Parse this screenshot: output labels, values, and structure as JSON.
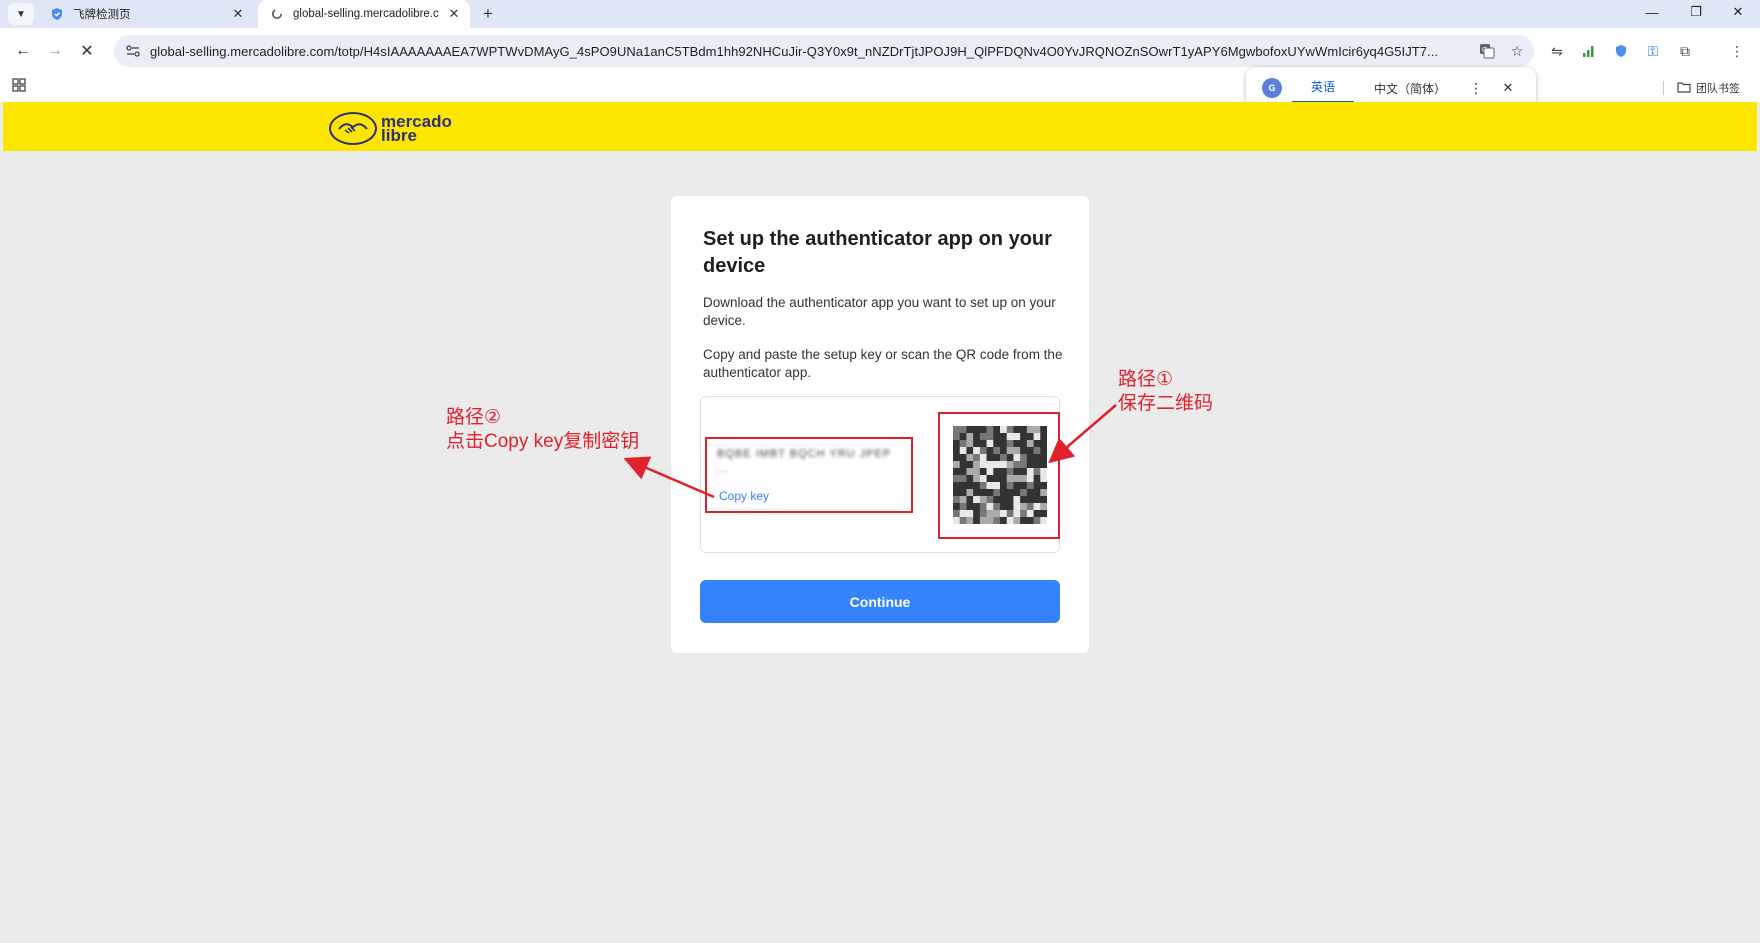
{
  "browser": {
    "tabs": [
      {
        "title": "飞牌检测页",
        "active": false
      },
      {
        "title": "global-selling.mercadolibre.c",
        "active": true
      }
    ],
    "url": "global-selling.mercadolibre.com/totp/H4sIAAAAAAAEA7WPTWvDMAyG_4sPO9UNa1anC5TBdm1hh92NHCuJir-Q3Y0x9t_nNZDrTjtJPOJ9H_QlPFDQNv4O0YvJRQNOZnSOwrT1yAPY6MgwbofoxUYwWmIcir6yq4G5IJT7...",
    "bookmark_folder": "团队书签",
    "translate": {
      "source_lang": "英语",
      "target_lang": "中文（简体）"
    }
  },
  "page": {
    "brand": {
      "line1": "mercado",
      "line2": "libre",
      "color": "#ffe600"
    },
    "title": "Set up the authenticator app on your device",
    "description1": "Download the authenticator app you want to set up on your device.",
    "description2": "Copy and paste the setup key or scan the QR code from the authenticator app.",
    "setup_key_masked": "BQBE IMBT BQCH YRU JPEP ...",
    "copy_key_label": "Copy key",
    "continue_label": "Continue",
    "accent_color": "#3483fa"
  },
  "annotations": {
    "path1_title": "路径①",
    "path1_text": "保存二维码",
    "path2_title": "路径②",
    "path2_text": "点击Copy key复制密钥",
    "color": "#e0222c"
  }
}
